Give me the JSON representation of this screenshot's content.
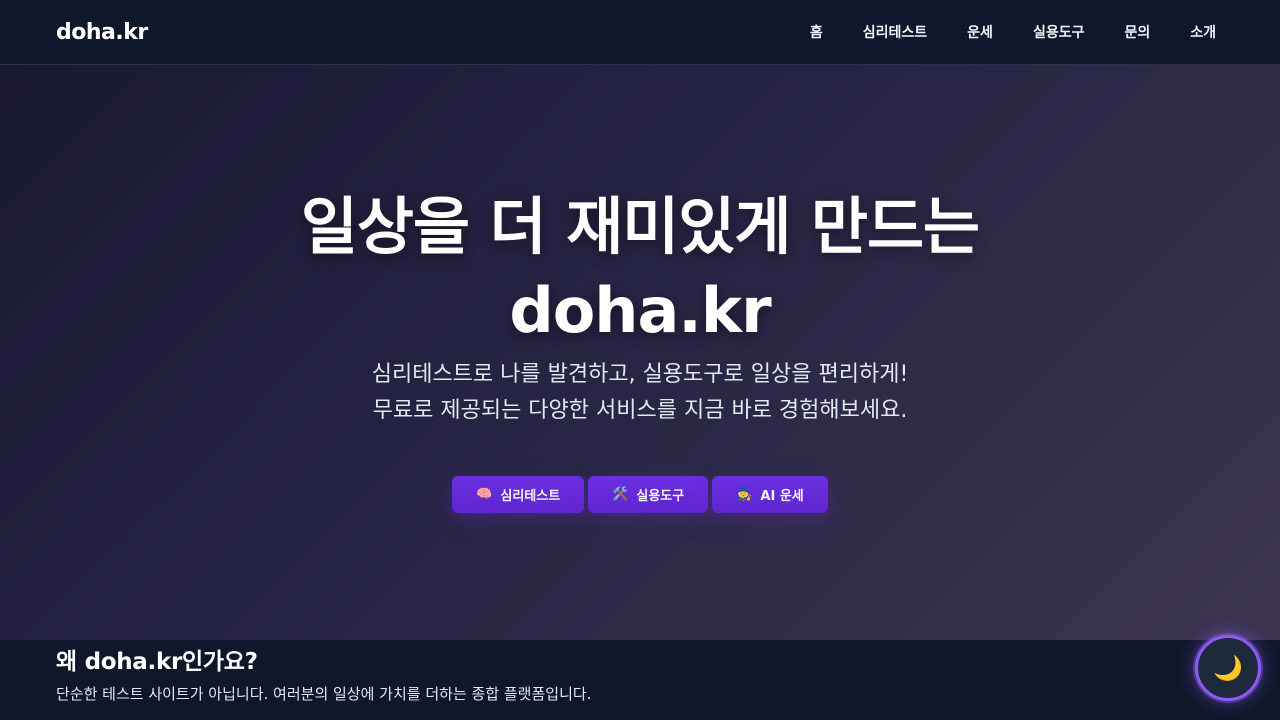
{
  "navbar": {
    "logo": "doha.kr",
    "links": [
      "홈",
      "심리테스트",
      "운세",
      "실용도구",
      "문의",
      "소개"
    ]
  },
  "hero": {
    "title_line1": "일상을 더 재미있게 만드는",
    "title_line2": "doha.kr",
    "subtitle_line1": "심리테스트로 나를 발견하고, 실용도구로 일상을 편리하게!",
    "subtitle_line2": "무료로 제공되는 다양한 서비스를 지금 바로 경험해보세요.",
    "buttons": [
      {
        "icon": "🧠",
        "icon_name": "brain-icon",
        "label": "심리테스트"
      },
      {
        "icon": "🛠️",
        "icon_name": "tools-icon",
        "label": "실용도구"
      },
      {
        "icon": "🧙",
        "icon_name": "fortune-teller-icon",
        "label": "AI 운세"
      }
    ]
  },
  "why": {
    "title": "왜 doha.kr인가요?",
    "description": "단순한 테스트 사이트가 아닙니다. 여러분의 일상에 가치를 더하는 종합 플랫폼입니다."
  },
  "theme_toggle": {
    "icon": "🌙",
    "icon_name": "moon-icon"
  },
  "colors": {
    "navbar_bg": "#0f172a",
    "accent": "#6d28d9",
    "toggle_border": "#8b5cf6"
  }
}
